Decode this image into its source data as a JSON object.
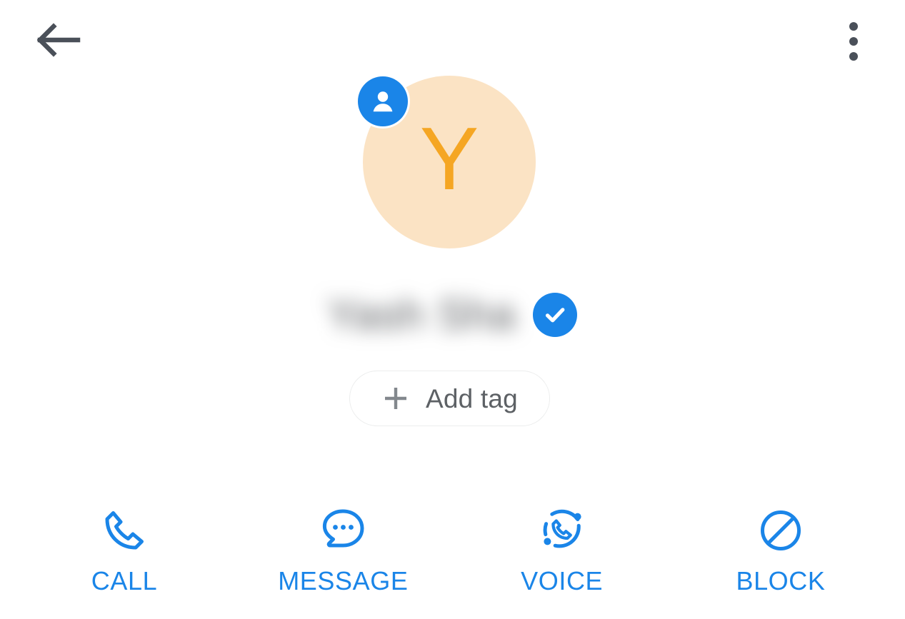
{
  "app": {
    "screen_name": "Contact details",
    "background_color": "#ffffff",
    "accent_color": "#1a85e8",
    "icon_gray": "#4a5059"
  },
  "top_bar": {
    "back_icon": "arrow-left-icon",
    "back_label": "Back",
    "overflow_icon": "more-vertical-icon",
    "overflow_label": "More options"
  },
  "profile": {
    "avatar": {
      "initial": "Y",
      "background_color": "#fbe3c4",
      "letter_color": "#f5a623",
      "badge_icon": "person-icon",
      "badge_color": "#1a85e8",
      "badge_label": "Profile photo"
    },
    "name": {
      "text": "Yash Sha",
      "redacted": true,
      "verified_icon": "verified-check-icon",
      "verified_color": "#1a85e8"
    },
    "add_tag": {
      "icon": "plus-icon",
      "label": "Add tag",
      "text_color": "#5d6165",
      "border_color": "#eceded"
    }
  },
  "actions": [
    {
      "id": "call",
      "icon": "phone-icon",
      "label": "CALL"
    },
    {
      "id": "message",
      "icon": "chat-bubble-icon",
      "label": "MESSAGE"
    },
    {
      "id": "voice",
      "icon": "voip-call-icon",
      "label": "VOICE"
    },
    {
      "id": "block",
      "icon": "block-icon",
      "label": "BLOCK"
    }
  ]
}
